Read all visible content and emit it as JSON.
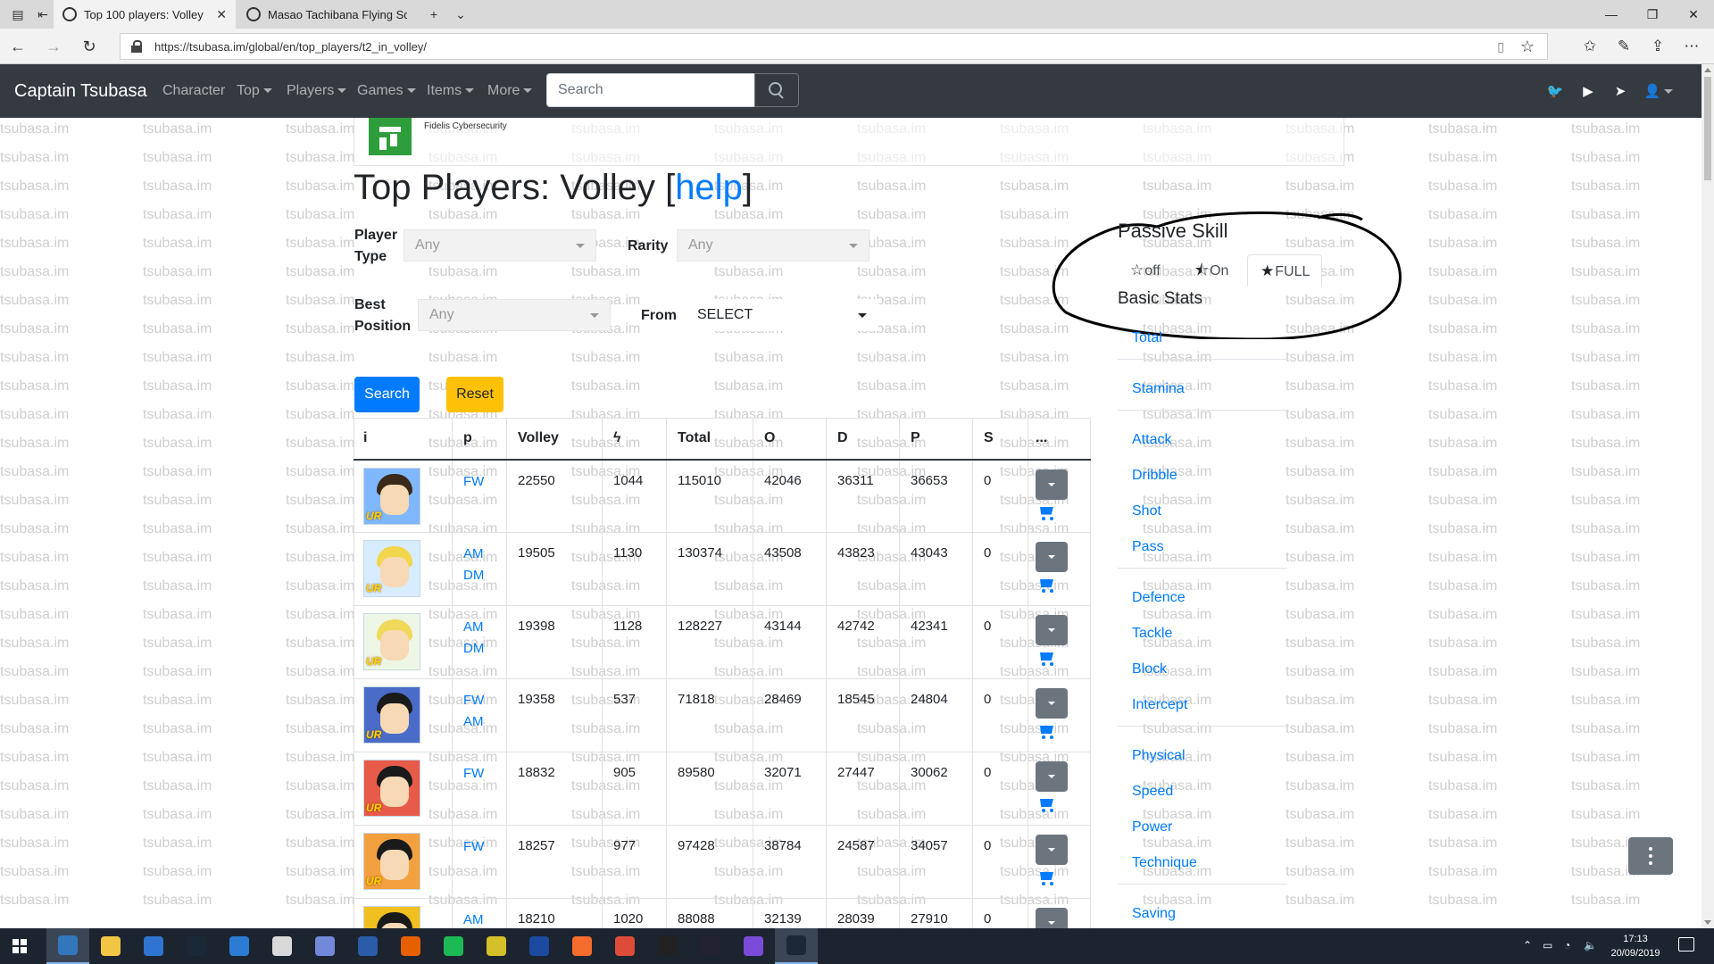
{
  "browser": {
    "tabs": [
      {
        "title": "Top 100 players: Volley |",
        "active": true
      },
      {
        "title": "Masao Tachibana Flying Squ",
        "active": false
      }
    ],
    "url": "https://tsubasa.im/global/en/top_players/t2_in_volley/"
  },
  "navbar": {
    "brand": "Captain Tsubasa",
    "items": [
      {
        "label": "Character",
        "dropdown": false
      },
      {
        "label": "Top",
        "dropdown": true
      },
      {
        "label": "Players",
        "dropdown": true
      },
      {
        "label": "Games",
        "dropdown": true
      },
      {
        "label": "Items",
        "dropdown": true
      },
      {
        "label": "More",
        "dropdown": true
      }
    ],
    "search_placeholder": "Search",
    "social_icons": [
      "twitter-icon",
      "youtube-icon",
      "telegram-icon",
      "user-icon"
    ]
  },
  "watermark": "tsubasa.im",
  "ad": {
    "text": "Fidelis Cybersecurity"
  },
  "page": {
    "title": "Top Players: Volley [",
    "help_link": "help",
    "title_end": "]"
  },
  "filters": {
    "player_type": {
      "label_line1": "Player",
      "label_line2": "Type",
      "value": "Any"
    },
    "rarity": {
      "label": "Rarity",
      "value": "Any"
    },
    "best_position": {
      "label_line1": "Best",
      "label_line2": "Position",
      "value": "Any"
    },
    "from": {
      "label": "From",
      "value": "SELECT"
    },
    "search_button": "Search",
    "reset_button": "Reset"
  },
  "table": {
    "headers": [
      "i",
      "p",
      "Volley",
      "ϟ",
      "Total",
      "O",
      "D",
      "P",
      "S",
      "..."
    ],
    "rows": [
      {
        "pos": [
          "FW"
        ],
        "volley": "22550",
        "bolt": "1044",
        "total": "115010",
        "o": "42046",
        "d": "36311",
        "p": "36653",
        "s": "0",
        "hair": "#3a2a1a",
        "bg": "#7fb8ff"
      },
      {
        "pos": [
          "AM",
          "DM"
        ],
        "volley": "19505",
        "bolt": "1130",
        "total": "130374",
        "o": "43508",
        "d": "43823",
        "p": "43043",
        "s": "0",
        "hair": "#f2d64b",
        "bg": "#d7ecff"
      },
      {
        "pos": [
          "AM",
          "DM"
        ],
        "volley": "19398",
        "bolt": "1128",
        "total": "128227",
        "o": "43144",
        "d": "42742",
        "p": "42341",
        "s": "0",
        "hair": "#f0d85a",
        "bg": "#eef6e6"
      },
      {
        "pos": [
          "FW",
          "AM"
        ],
        "volley": "19358",
        "bolt": "537",
        "total": "71818",
        "o": "28469",
        "d": "18545",
        "p": "24804",
        "s": "0",
        "hair": "#1a1a1a",
        "bg": "#4a6cc8"
      },
      {
        "pos": [
          "FW"
        ],
        "volley": "18832",
        "bolt": "905",
        "total": "89580",
        "o": "32071",
        "d": "27447",
        "p": "30062",
        "s": "0",
        "hair": "#1a1a1a",
        "bg": "#e85a4a"
      },
      {
        "pos": [
          "FW"
        ],
        "volley": "18257",
        "bolt": "977",
        "total": "97428",
        "o": "38784",
        "d": "24587",
        "p": "34057",
        "s": "0",
        "hair": "#1a1a1a",
        "bg": "#f3a040"
      },
      {
        "pos": [
          "AM"
        ],
        "volley": "18210",
        "bolt": "1020",
        "total": "88088",
        "o": "32139",
        "d": "28039",
        "p": "27910",
        "s": "0",
        "hair": "#1a1a1a",
        "bg": "#f0c020"
      }
    ]
  },
  "sidebar": {
    "passive_skill_title": "Passive Skill",
    "toggles": [
      {
        "label": "off",
        "icon": "star-outline-icon",
        "active": false
      },
      {
        "label": "On",
        "icon": "star-half-icon",
        "active": false
      },
      {
        "label": "FULL",
        "icon": "star-full-icon",
        "active": true
      }
    ],
    "basic_stats_title": "Basic Stats",
    "groups": [
      [
        "Total"
      ],
      [
        "Stamina"
      ],
      [
        "Attack",
        "Dribble",
        "Shot",
        "Pass"
      ],
      [
        "Defence",
        "Tackle",
        "Block",
        "Intercept"
      ],
      [
        "Physical",
        "Speed",
        "Power",
        "Technique"
      ],
      [
        "Saving"
      ]
    ]
  },
  "taskbar": {
    "time": "17:13",
    "date": "20/09/2019"
  }
}
